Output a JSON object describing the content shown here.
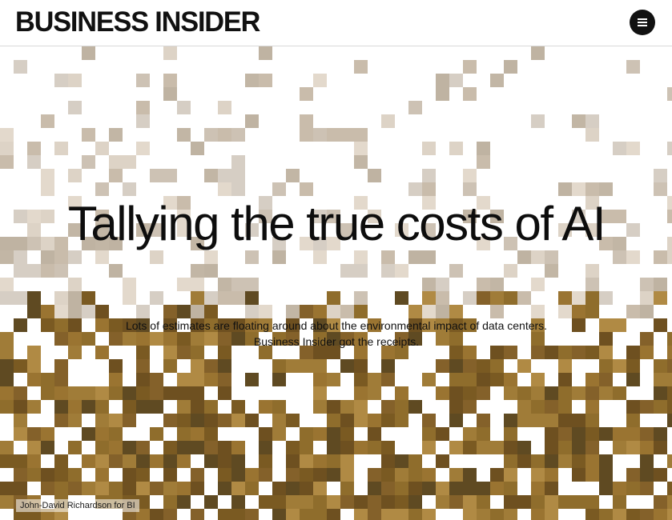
{
  "header": {
    "logo": "BUSINESS INSIDER",
    "menu_icon": "hamburger-menu-icon"
  },
  "article": {
    "title": "Tallying the true costs of AI",
    "subtitle": "Lots of estimates are floating around about the environmental impact of data centers. Business Insider got the receipts.",
    "photo_credit": "John-David Richardson for BI"
  },
  "colors": {
    "background": "#ffffff",
    "text": "#0d0d0d",
    "menu_button": "#111111",
    "sky_tile": "#cfc4b8",
    "field_tile": "#8a6a2a"
  }
}
